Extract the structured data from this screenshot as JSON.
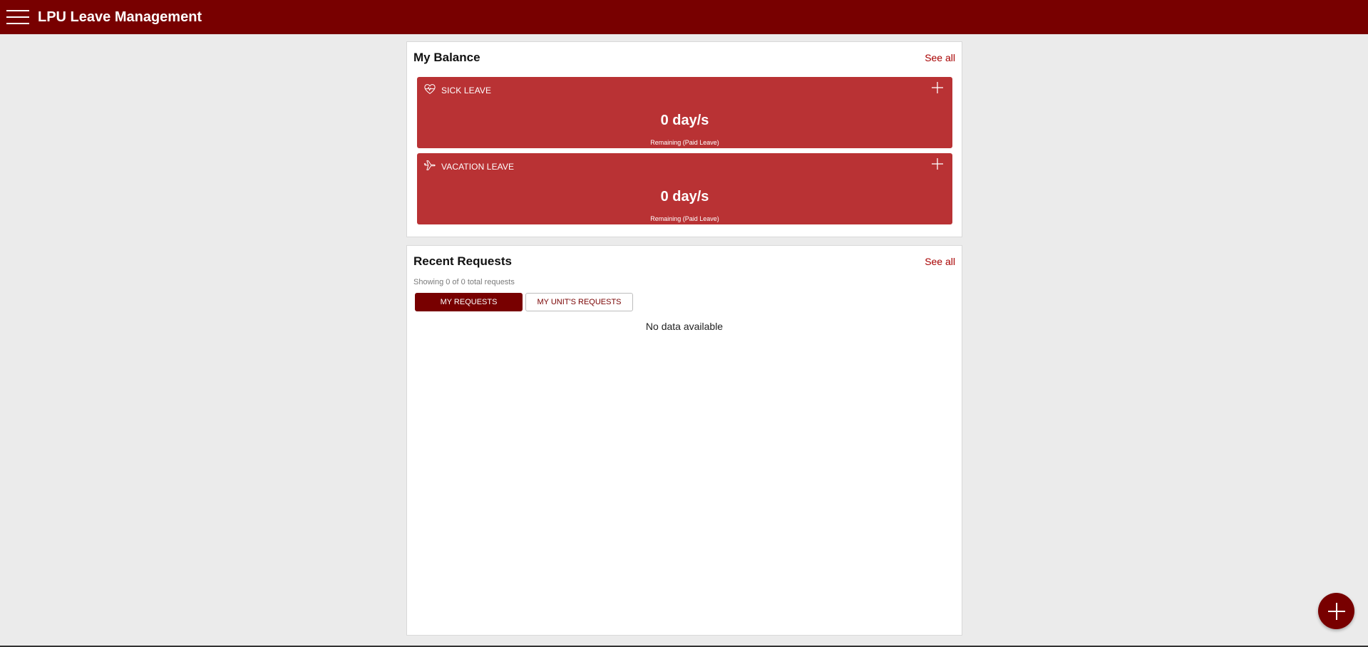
{
  "header": {
    "app_title": "LPU Leave Management",
    "menu_icon": "hamburger-menu-icon"
  },
  "balance": {
    "title": "My Balance",
    "see_all": "See all",
    "cards": [
      {
        "name": "SICK LEAVE",
        "icon": "heartbeat-icon",
        "days": "0 day/s",
        "subtitle": "Remaining (Paid Leave)"
      },
      {
        "name": "VACATION LEAVE",
        "icon": "airplane-icon",
        "days": "0 day/s",
        "subtitle": "Remaining (Paid Leave)"
      }
    ]
  },
  "requests": {
    "title": "Recent Requests",
    "see_all": "See all",
    "showing": "Showing 0 of 0 total requests",
    "tabs": [
      {
        "label": "MY REQUESTS",
        "active": true
      },
      {
        "label": "MY UNIT'S REQUESTS",
        "active": false
      }
    ],
    "empty_text": "No data available"
  },
  "fab": {
    "icon": "plus-icon"
  },
  "colors": {
    "header_bg": "#780000",
    "card_bg": "#b93234",
    "accent_text": "#a80000",
    "page_bg": "#ebebeb"
  }
}
